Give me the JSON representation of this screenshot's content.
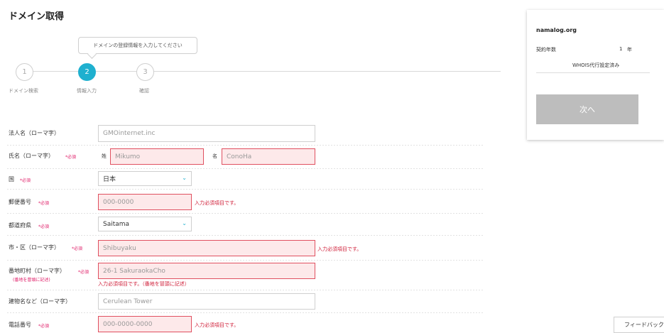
{
  "page": {
    "title": "ドメイン取得"
  },
  "tooltip": "ドメインの登録情報を入力してください",
  "steps": [
    {
      "num": "1",
      "label": "ドメイン検索"
    },
    {
      "num": "2",
      "label": "情報入力"
    },
    {
      "num": "3",
      "label": "確認"
    }
  ],
  "required": "*必須",
  "form": {
    "corp": {
      "label": "法人名（ローマ字）",
      "value": "GMOinternet.inc"
    },
    "name": {
      "label": "氏名（ローマ字）",
      "last_label": "姓",
      "last_value": "Mikumo",
      "first_label": "名",
      "first_value": "ConoHa"
    },
    "country": {
      "label": "国",
      "value": "日本"
    },
    "zip": {
      "label": "郵便番号",
      "placeholder": "000-0000",
      "error": "入力必須項目です。"
    },
    "prefecture": {
      "label": "都道府県",
      "value": "Saitama"
    },
    "city": {
      "label": "市・区（ローマ字）",
      "placeholder": "Shibuyaku",
      "error": "入力必須項目です。"
    },
    "street": {
      "label": "番地町村（ローマ字）",
      "sub": "(番地を冒頭に記述)",
      "placeholder": "26-1 SakuraokaCho",
      "error": "入力必須項目です。（番地を冒頭に記述）"
    },
    "building": {
      "label": "建物名など（ローマ字）",
      "placeholder": "Cerulean Tower"
    },
    "phone": {
      "label": "電話番号",
      "placeholder": "000-0000-0000",
      "error": "入力必須項目です。"
    }
  },
  "summary": {
    "domain": "namalog.org",
    "term_label": "契約年数",
    "term_value": "1",
    "term_unit": "年",
    "whois": "WHOIS代行設定済み",
    "next_label": "次へ"
  },
  "feedback": "フィードバック"
}
